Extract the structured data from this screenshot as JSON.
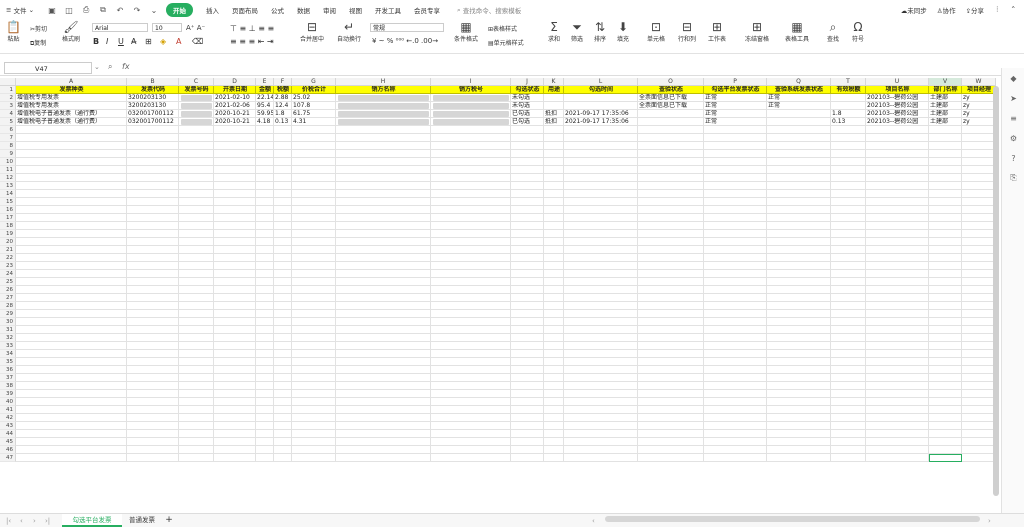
{
  "menu": {
    "file": "文件",
    "tabs": [
      "开始",
      "插入",
      "页面布局",
      "公式",
      "数据",
      "审阅",
      "视图",
      "开发工具",
      "会员专享"
    ],
    "search_placeholder": "查找命令、搜索模板",
    "right": [
      "未同步",
      "协作",
      "分享"
    ]
  },
  "ribbon": {
    "paste": "粘贴",
    "cut": "剪切",
    "copy": "复制",
    "format_painter": "格式刷",
    "font": "Arial",
    "size": "10",
    "merge": "合并居中",
    "wrap": "自动换行",
    "number_format": "常规",
    "cond_format": "条件格式",
    "table_style": "表格样式",
    "cell_style": "单元格样式",
    "sum": "求和",
    "filter": "筛选",
    "sort": "排序",
    "fill": "填充",
    "cell": "单元格",
    "rowcol": "行和列",
    "worksheet": "工作表",
    "freeze": "冻结窗格",
    "table_tools": "表格工具",
    "find": "查找",
    "symbol": "符号"
  },
  "formula_bar": {
    "cell_ref": "V47",
    "fx": "fx",
    "value": ""
  },
  "columns": [
    "A",
    "B",
    "C",
    "D",
    "E",
    "F",
    "G",
    "H",
    "I",
    "J",
    "K",
    "L",
    "O",
    "P",
    "Q",
    "T",
    "U",
    "V",
    "W"
  ],
  "headers": [
    "发票种类",
    "发票代码",
    "发票号码",
    "开票日期",
    "金额",
    "税额",
    "价税合计",
    "销方名称",
    "销方税号",
    "勾选状态",
    "用途",
    "勾选时间",
    "查验状态",
    "勾选平台发票状态",
    "查验系统发票状态",
    "有效税额",
    "项目名称",
    "部门名称",
    "项目经理"
  ],
  "rows": [
    [
      "增值税专用发票",
      "3200203130",
      "",
      "2021-02-10",
      "22.14",
      "2.88",
      "25.02",
      "",
      "",
      "未勾选",
      "",
      "",
      "全票面信息已下载",
      "正常",
      "正常",
      "",
      "202103--碧荷公园",
      "土建部",
      "zy"
    ],
    [
      "增值税专用发票",
      "3200203130",
      "",
      "2021-02-06",
      "95.4",
      "12.4",
      "107.8",
      "",
      "",
      "未勾选",
      "",
      "",
      "全票面信息已下载",
      "正常",
      "正常",
      "",
      "202103--碧荷公园",
      "土建部",
      "zy"
    ],
    [
      "增值税电子普通发票（通行费）",
      "032001700112",
      "",
      "2020-10-21",
      "59.95",
      "1.8",
      "61.75",
      "",
      "",
      "已勾选",
      "抵扣",
      "2021-09-17 17:35:06",
      "",
      "正常",
      "",
      "1.8",
      "202103--碧荷公园",
      "土建部",
      "zy"
    ],
    [
      "增值税电子普通发票（通行费）",
      "032001700112",
      "",
      "2020-10-21",
      "4.18",
      "0.13",
      "4.31",
      "",
      "",
      "已勾选",
      "抵扣",
      "2021-09-17 17:35:06",
      "",
      "正常",
      "",
      "0.13",
      "202103--碧荷公园",
      "土建部",
      "zy"
    ]
  ],
  "row_count": 47,
  "sheet_tabs": [
    "勾选平台发票",
    "普通发票"
  ],
  "add_sheet": "+"
}
